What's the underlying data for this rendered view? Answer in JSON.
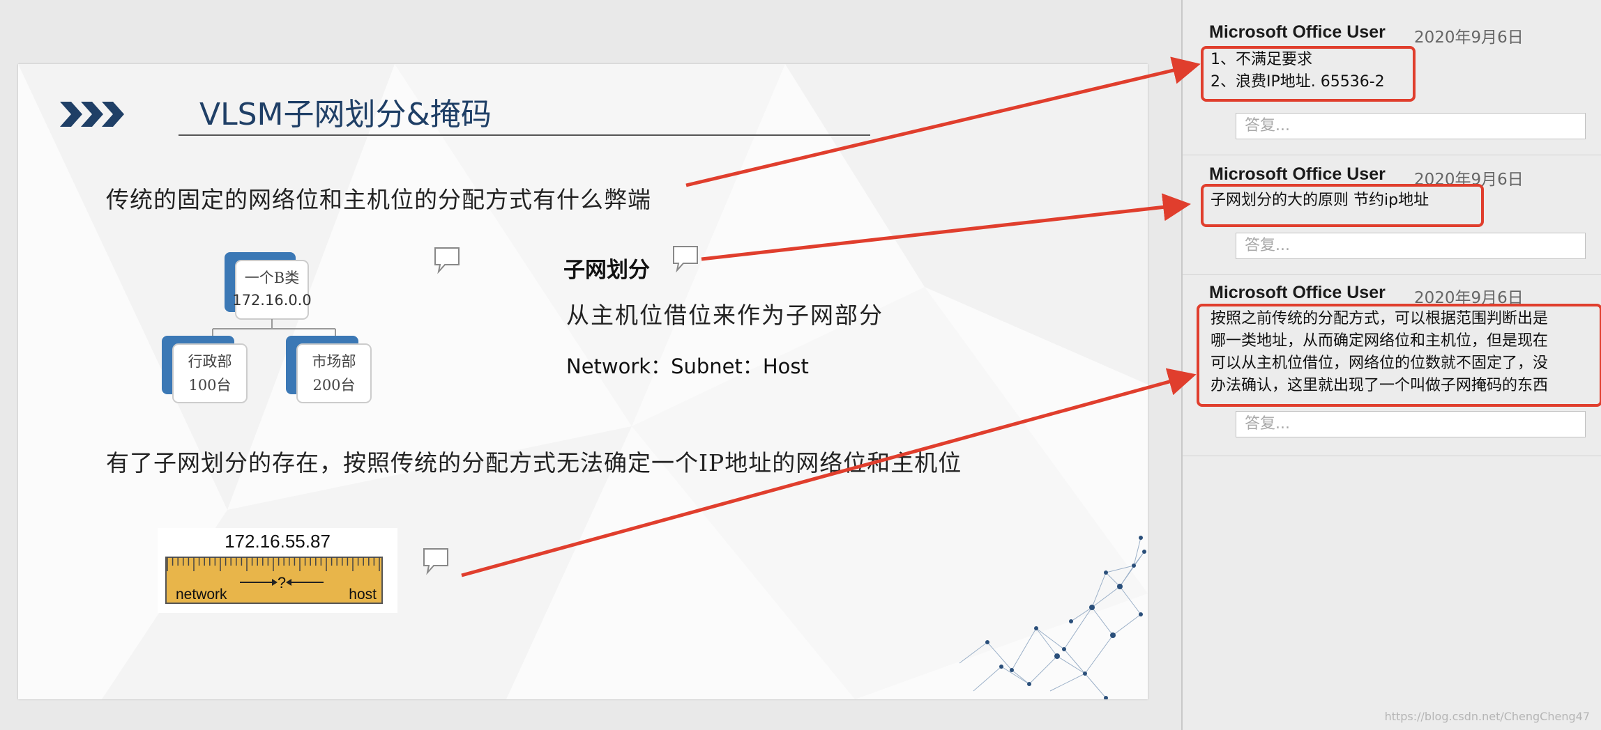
{
  "slide": {
    "title": "VLSM子网划分&掩码",
    "question1": "传统的固定的网络位和主机位的分配方式有什么弊端",
    "diagram": {
      "root_line1": "一个B类",
      "root_line2": "172.16.0.0",
      "left_line1": "行政部",
      "left_line2": "100台",
      "right_line1": "市场部",
      "right_line2": "200台"
    },
    "subnet_title": "子网划分",
    "subnet_desc": "从主机位借位来作为子网部分",
    "subnet_format": "Network：Subnet：Host",
    "question2": "有了子网划分的存在，按照传统的分配方式无法确定一个IP地址的网络位和主机位",
    "ruler": {
      "ip": "172.16.55.87",
      "left_label": "network",
      "middle_label": "?",
      "right_label": "host"
    }
  },
  "comments": [
    {
      "author": "Microsoft Office User",
      "date": "2020年9月6日",
      "lines": [
        "1、不满足要求",
        "2、浪费IP地址. 65536-2"
      ],
      "reply_placeholder": "答复..."
    },
    {
      "author": "Microsoft Office User",
      "date": "2020年9月6日",
      "lines": [
        "子网划分的大的原则   节约ip地址"
      ],
      "reply_placeholder": "答复..."
    },
    {
      "author": "Microsoft Office User",
      "date": "2020年9月6日",
      "lines": [
        "按照之前传统的分配方式，可以根据范围判断出是",
        "哪一类地址，从而确定网络位和主机位，但是现在",
        "可以从主机位借位，网络位的位数就不固定了，没",
        "办法确认，这里就出现了一个叫做子网掩码的东西"
      ],
      "reply_placeholder": "答复..."
    }
  ],
  "watermark": "https://blog.csdn.net/ChengCheng47",
  "colors": {
    "title": "#1f3f66",
    "annotation_red": "#e03e2d",
    "diagram_blue": "#3b78b5",
    "ruler_yellow": "#e8b54a"
  }
}
